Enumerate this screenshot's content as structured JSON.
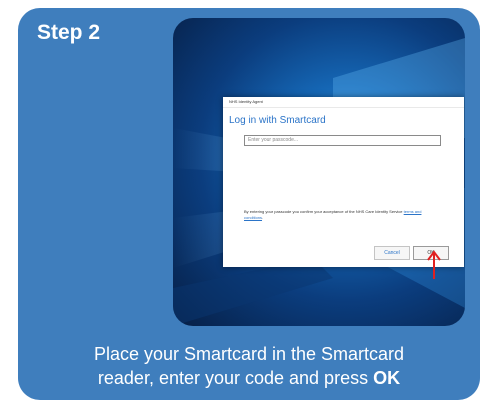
{
  "step": {
    "title": "Step 2"
  },
  "dialog": {
    "window_title": "NHS Identity Agent",
    "heading": "Log in with Smartcard",
    "passcode_placeholder": "Enter your passcode...",
    "terms_text": "By entering your passcode you confirm your acceptance of the NHS Care Identity Service",
    "terms_link": "terms and conditions",
    "terms_end": ".",
    "cancel_label": "Cancel",
    "ok_label": "OK"
  },
  "arrow": {
    "icon": "up-arrow-icon",
    "color": "#e02020"
  },
  "caption": {
    "line1": "Place your Smartcard in the Smartcard",
    "line2": "reader, enter your code and press ",
    "emphasis": "OK"
  },
  "colors": {
    "card_background": "#3f7ebd",
    "dialog_accent": "#2b74c8"
  }
}
